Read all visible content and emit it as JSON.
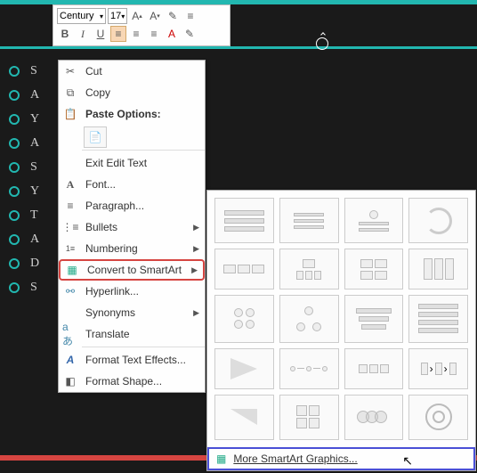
{
  "toolbar": {
    "font_name": "Century",
    "font_size": "17"
  },
  "bullets": [
    "S",
    "A",
    "Y",
    "A",
    "S",
    "Y",
    "T",
    "A",
    "D",
    "S"
  ],
  "menu": {
    "cut": "Cut",
    "copy": "Copy",
    "paste_options": "Paste Options:",
    "exit_edit": "Exit Edit Text",
    "font": "Font...",
    "paragraph": "Paragraph...",
    "bullets": "Bullets",
    "numbering": "Numbering",
    "convert_smartart": "Convert to SmartArt",
    "hyperlink": "Hyperlink...",
    "synonyms": "Synonyms",
    "translate": "Translate",
    "format_text": "Format Text Effects...",
    "format_shape": "Format Shape..."
  },
  "flyout": {
    "more": "More SmartArt Graphics..."
  }
}
